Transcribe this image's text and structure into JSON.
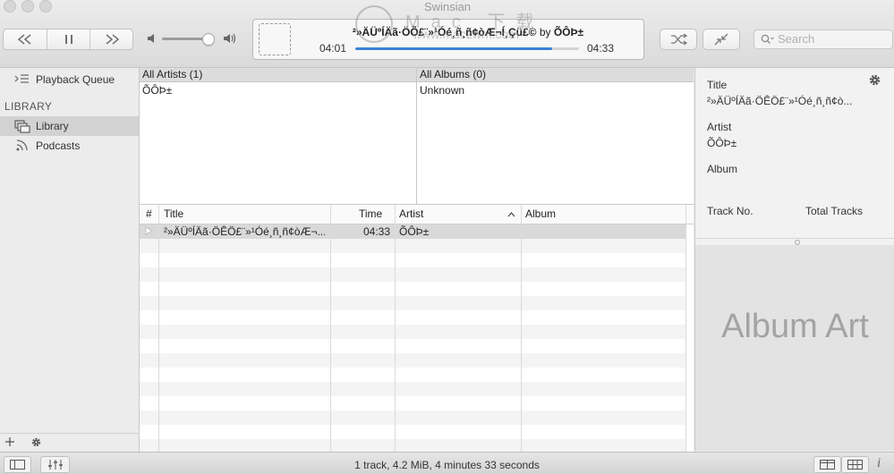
{
  "window": {
    "title": "Swinsian"
  },
  "transport": {
    "previous_icon": "rewind-icon",
    "pause_icon": "pause-icon",
    "next_icon": "fast-forward-icon",
    "volume_low_icon": "speaker-icon",
    "volume_high_icon": "speaker-loud-icon",
    "volume_level": 0.88
  },
  "now_playing": {
    "title": "²»ÄÜºÍÄã·ÖÕ£¨»¹Óé¸ñ¸ñ¢òÆ¬Í¸Çü£©",
    "by": "by",
    "artist": "ÕÔÞ±",
    "elapsed": "04:01",
    "total": "04:33",
    "progress": 0.88
  },
  "toolbar_right": {
    "shuffle_icon": "shuffle-icon",
    "minimize_icon": "collapse-arrows-icon"
  },
  "search": {
    "placeholder": "Search"
  },
  "watermark": {
    "text": "Mac 下载",
    "url": "www.maczwm.com"
  },
  "sidebar": {
    "queue_label": "Playback Queue",
    "heading": "LIBRARY",
    "items": [
      {
        "label": "Library",
        "icon": "library-icon"
      },
      {
        "label": "Podcasts",
        "icon": "podcast-icon"
      }
    ]
  },
  "browser": {
    "artists_header": "All Artists (1)",
    "artists": [
      "ÕÔÞ±"
    ],
    "albums_header": "All Albums (0)",
    "albums": [
      "Unknown"
    ]
  },
  "table": {
    "columns": [
      "#",
      "Title",
      "Time",
      "Artist",
      "Album"
    ],
    "rows": [
      {
        "num": "",
        "title": "²»ÄÜºÍÄã·ÖÊÖ£¨»¹Óé¸ñ¸ñ¢òÆ¬...",
        "time": "04:33",
        "artist": "ÕÔÞ±",
        "album": ""
      }
    ]
  },
  "inspector": {
    "title_label": "Title",
    "title_value": "²»ÄÜºÍÄã·ÖÊÖ£¨»¹Óé¸ñ¸ñ¢ò...",
    "artist_label": "Artist",
    "artist_value": "ÕÔÞ±",
    "album_label": "Album",
    "album_value": "",
    "track_label": "Track No.",
    "total_label": "Total Tracks",
    "art_placeholder": "Album Art"
  },
  "status": {
    "summary": "1 track,  4.2 MiB,  4 minutes 33 seconds"
  }
}
